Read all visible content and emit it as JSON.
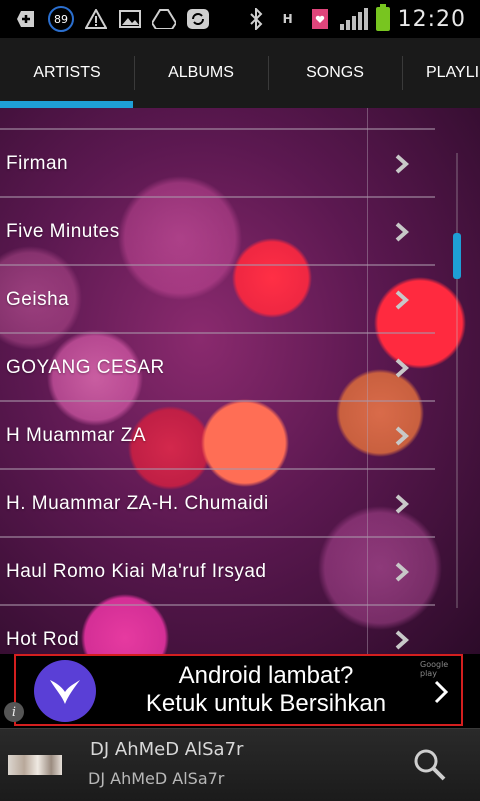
{
  "status_bar": {
    "notification_count": "89",
    "time": "12:20",
    "icons": [
      "plus-icon",
      "count-badge-icon",
      "warning-icon",
      "image-icon",
      "drive-icon",
      "sync-icon",
      "bluetooth-icon",
      "hspa-icon",
      "message-icon",
      "signal-icon",
      "battery-icon"
    ]
  },
  "tabs": [
    {
      "label": "ARTISTS",
      "selected": true
    },
    {
      "label": "ALBUMS",
      "selected": false
    },
    {
      "label": "SONGS",
      "selected": false
    },
    {
      "label": "PLAYLI",
      "selected": false
    }
  ],
  "artists": [
    {
      "name": "Firman"
    },
    {
      "name": "Five Minutes"
    },
    {
      "name": "Geisha"
    },
    {
      "name": "GOYANG CESAR"
    },
    {
      "name": "H Muammar ZA"
    },
    {
      "name": "H. Muammar ZA-H. Chumaidi"
    },
    {
      "name": "Haul Romo Kiai Ma'ruf Irsyad"
    },
    {
      "name": "Hot Rod"
    }
  ],
  "ad": {
    "line1": "Android lambat?",
    "line2": "Ketuk untuk Bersihkan",
    "store_badge": "Google play",
    "info_symbol": "i"
  },
  "now_playing": {
    "title": "DJ AhMeD AlSa7r",
    "artist": "DJ AhMeD AlSa7r"
  },
  "colors": {
    "accent": "#1e9fd6",
    "ad_border": "#d41f1f",
    "ad_logo": "#5a3fd6",
    "battery": "#78c520"
  }
}
